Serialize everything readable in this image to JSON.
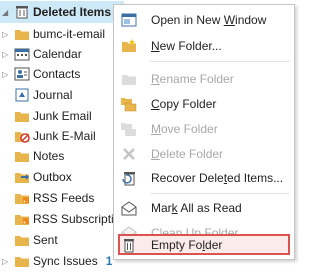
{
  "folders": [
    {
      "label": "Deleted Items",
      "bold": true,
      "selected": true,
      "chevron": "open",
      "icon": "trash-icon"
    },
    {
      "label": "bumc-it-email",
      "chevron": "closed",
      "icon": "folder-icon"
    },
    {
      "label": "Calendar",
      "chevron": "closed",
      "icon": "calendar-icon"
    },
    {
      "label": "Contacts",
      "chevron": "closed",
      "icon": "contacts-icon"
    },
    {
      "label": "Journal",
      "icon": "journal-icon"
    },
    {
      "label": "Junk Email",
      "icon": "folder-icon"
    },
    {
      "label": "Junk E-Mail",
      "icon": "junk-icon"
    },
    {
      "label": "Notes",
      "icon": "folder-icon"
    },
    {
      "label": "Outbox",
      "icon": "outbox-icon"
    },
    {
      "label": "RSS Feeds",
      "icon": "rss-icon"
    },
    {
      "label": "RSS Subscription",
      "icon": "rss-icon"
    },
    {
      "label": "Sent",
      "icon": "folder-icon"
    },
    {
      "label": "Sync Issues",
      "badge": "1",
      "chevron": "closed",
      "icon": "sync-icon"
    }
  ],
  "menu": [
    {
      "pre": "Open in New ",
      "ul": "W",
      "post": "indow",
      "icon": "new-window-icon",
      "enabled": true
    },
    {
      "pre": "",
      "ul": "N",
      "post": "ew Folder...",
      "icon": "new-folder-icon",
      "enabled": true
    },
    {
      "pre": "",
      "ul": "R",
      "post": "ename Folder",
      "icon": "rename-folder-icon",
      "enabled": false
    },
    {
      "pre": "",
      "ul": "C",
      "post": "opy Folder",
      "icon": "copy-folder-icon",
      "enabled": true
    },
    {
      "pre": "",
      "ul": "M",
      "post": "ove Folder",
      "icon": "move-folder-icon",
      "enabled": false
    },
    {
      "pre": "",
      "ul": "D",
      "post": "elete Folder",
      "icon": "delete-folder-icon",
      "enabled": false
    },
    {
      "pre": "Recover Dele",
      "ul": "t",
      "post": "ed Items...",
      "icon": "recover-icon",
      "enabled": true
    },
    {
      "pre": "Mar",
      "ul": "k",
      "post": " All as Read",
      "icon": "mark-read-icon",
      "enabled": true
    },
    {
      "pre": "C",
      "ul": "l",
      "post": "ean Up Folder",
      "icon": "cleanup-icon",
      "enabled": false
    },
    {
      "pre": "Empty Fo",
      "ul": "l",
      "post": "der",
      "icon": "empty-folder-icon",
      "enabled": true,
      "highlight": true
    }
  ],
  "colors": {
    "selection": "#cde8f7",
    "highlight_border": "#d9534f",
    "folder": "#e8b44c",
    "accent": "#2a7ab5"
  }
}
